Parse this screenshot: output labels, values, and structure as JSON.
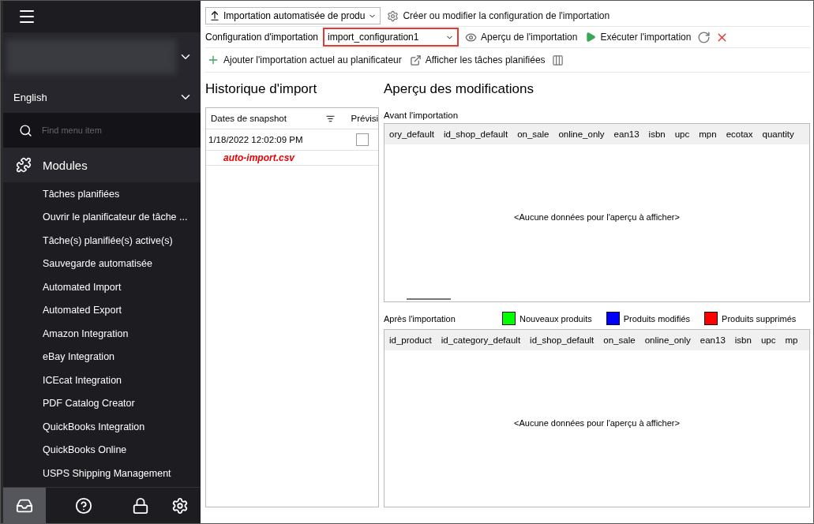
{
  "sidebar": {
    "language": "English",
    "search": {
      "placeholder": "Find menu item"
    },
    "section": "Modules",
    "items": [
      {
        "label": "Tâches planifiées"
      },
      {
        "label": "Ouvrir le planificateur de tâche ..."
      },
      {
        "label": "Tâche(s) planifiée(s) active(s)"
      },
      {
        "label": "Sauvegarde automatisée"
      },
      {
        "label": "Automated Import"
      },
      {
        "label": "Automated Export"
      },
      {
        "label": "Amazon Integration"
      },
      {
        "label": "eBay Integration"
      },
      {
        "label": "ICEcat Integration"
      },
      {
        "label": "PDF Catalog Creator"
      },
      {
        "label": "QuickBooks Integration"
      },
      {
        "label": "QuickBooks Online"
      },
      {
        "label": "USPS Shipping Management"
      }
    ],
    "footer": [
      {
        "kind": "inbox",
        "selected": true
      },
      {
        "kind": "help",
        "selected": false
      },
      {
        "kind": "lock",
        "selected": false
      },
      {
        "kind": "settings",
        "selected": false
      }
    ]
  },
  "toolbar": {
    "module_select": "Importation automatisée de produ",
    "configure": {
      "label": "Créer ou modifier la configuration de l'importation"
    },
    "config_label": "Configuration d'importation",
    "config_value": "import_configuration1",
    "preview": {
      "label": "Aperçu de l'importation"
    },
    "run": {
      "label": "Exécuter l'importation"
    },
    "add": {
      "label": "Ajouter l'importation actuel au planificateur"
    },
    "show": {
      "label": "Afficher les tâches planifiées"
    }
  },
  "history": {
    "title": "Historique d'import",
    "columns": [
      "Dates de snapshot",
      "Prévisi"
    ],
    "rows": [
      {
        "date": "1/18/2022 12:02:09 PM",
        "checked": false,
        "file": "auto-import.csv"
      }
    ]
  },
  "preview": {
    "title": "Aperçu des modifications",
    "before": {
      "label": "Avant l'importation",
      "columns": [
        "ory_default",
        "id_shop_default",
        "on_sale",
        "online_only",
        "ean13",
        "isbn",
        "upc",
        "mpn",
        "ecotax",
        "quantity"
      ],
      "empty": "<Aucune données pour l'aperçu à afficher>"
    },
    "after": {
      "label": "Après l'importation",
      "columns": [
        "id_product",
        "id_category_default",
        "id_shop_default",
        "on_sale",
        "online_only",
        "ean13",
        "isbn",
        "upc",
        "mp"
      ],
      "empty": "<Aucune données pour l'aperçu à afficher>"
    },
    "legend": [
      {
        "label": "Nouveaux produits",
        "color": "#00ff00"
      },
      {
        "label": "Produits modifiés",
        "color": "#0000ff"
      },
      {
        "label": "Produits supprimés",
        "color": "#ff0000"
      }
    ]
  }
}
